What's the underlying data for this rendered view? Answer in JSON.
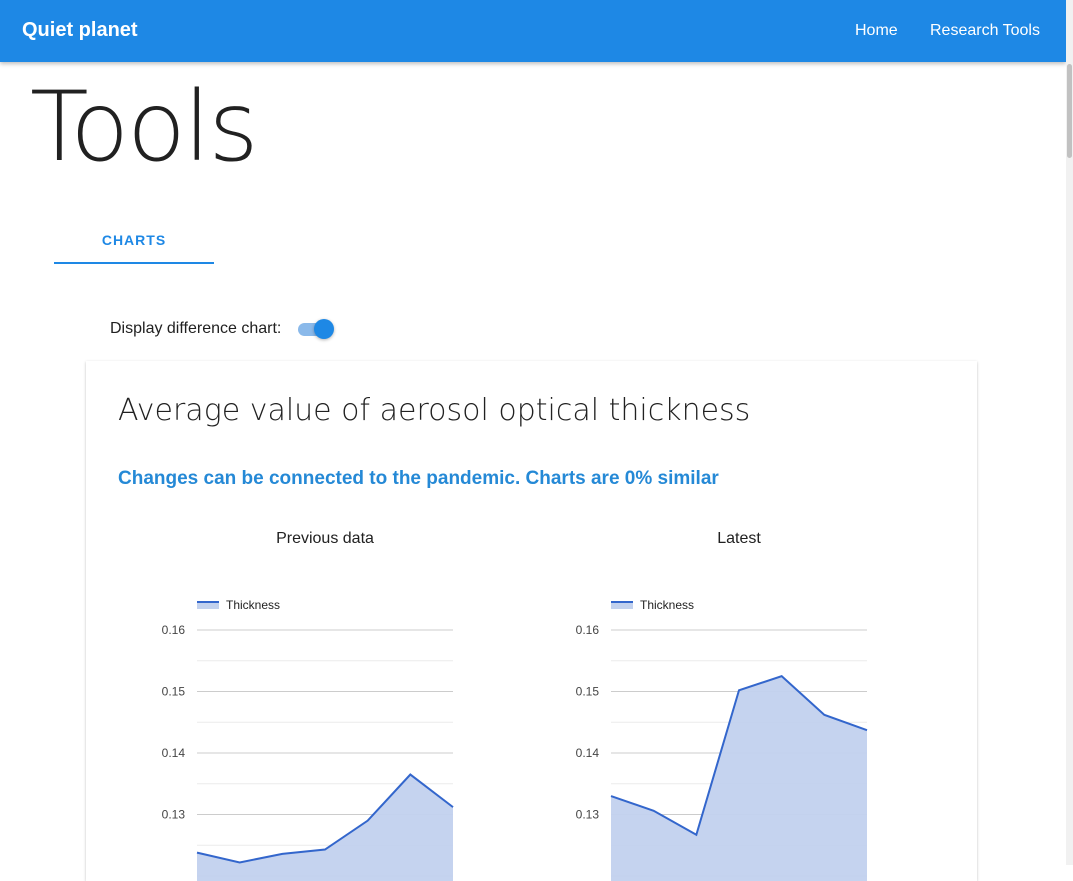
{
  "appbar": {
    "brand": "Quiet planet",
    "nav": [
      "Home",
      "Research Tools"
    ]
  },
  "page": {
    "title": "Tools",
    "tab_label": "CHARTS"
  },
  "controls": {
    "difference_label": "Display difference chart:",
    "difference_enabled": true
  },
  "card": {
    "title": "Average value of aerosol optical thickness",
    "subtitle": "Changes can be connected to the pandemic. Charts are 0% similar"
  },
  "colors": {
    "primary": "#1e88e5",
    "line": "#3366cc",
    "area": "#c2d1ee"
  },
  "chart_data": [
    {
      "type": "area",
      "title": "Previous data",
      "series": [
        {
          "name": "Thickness",
          "values": [
            0.1238,
            0.1222,
            0.1236,
            0.1243,
            0.129,
            0.1365,
            0.1312
          ]
        }
      ],
      "yticks": [
        0.13,
        0.14,
        0.15,
        0.16
      ],
      "ylim": [
        0.12,
        0.16
      ],
      "legend": "top-left",
      "grid": true
    },
    {
      "type": "area",
      "title": "Latest",
      "series": [
        {
          "name": "Thickness",
          "values": [
            0.133,
            0.1306,
            0.1267,
            0.1502,
            0.1525,
            0.1462,
            0.1437
          ]
        }
      ],
      "yticks": [
        0.13,
        0.14,
        0.15,
        0.16
      ],
      "ylim": [
        0.12,
        0.16
      ],
      "legend": "top-left",
      "grid": true
    }
  ]
}
